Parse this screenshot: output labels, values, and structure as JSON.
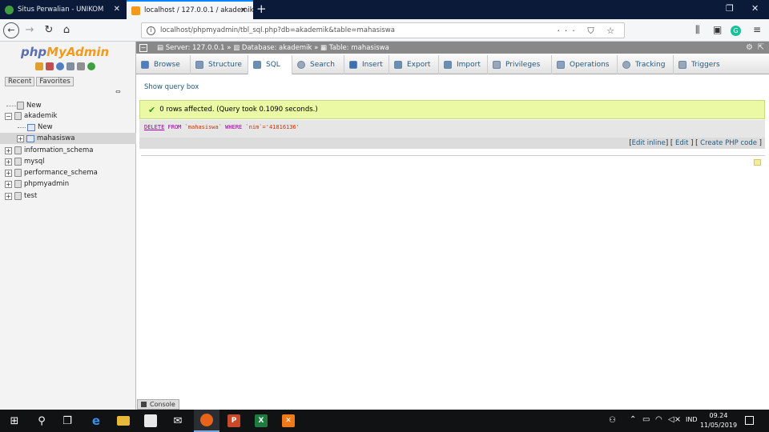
{
  "browser": {
    "tabs": [
      {
        "title": "Situs Perwalian - UNIKOM",
        "active": false
      },
      {
        "title": "localhost / 127.0.0.1 / akademik",
        "active": true
      }
    ],
    "new_tab": "+",
    "url": "localhost/phpmyadmin/tbl_sql.php?db=akademik&table=mahasiswa",
    "url_icons": "··· ⛉ ☆"
  },
  "sidebar": {
    "logo_php": "php",
    "logo_myadmin": "MyAdmin",
    "recent": "Recent",
    "favorites": "Favorites",
    "tree": [
      {
        "label": "New",
        "level": 0,
        "kind": "new"
      },
      {
        "label": "akademik",
        "level": 0,
        "kind": "db",
        "expander": "−"
      },
      {
        "label": "New",
        "level": 1,
        "kind": "new"
      },
      {
        "label": "mahasiswa",
        "level": 1,
        "kind": "table",
        "expander": "+",
        "selected": true
      },
      {
        "label": "information_schema",
        "level": 0,
        "kind": "db",
        "expander": "+"
      },
      {
        "label": "mysql",
        "level": 0,
        "kind": "db",
        "expander": "+"
      },
      {
        "label": "performance_schema",
        "level": 0,
        "kind": "db",
        "expander": "+"
      },
      {
        "label": "phpmyadmin",
        "level": 0,
        "kind": "db",
        "expander": "+"
      },
      {
        "label": "test",
        "level": 0,
        "kind": "db",
        "expander": "+"
      }
    ]
  },
  "breadcrumb": {
    "server": "Server: 127.0.0.1",
    "database": "Database: akademik",
    "table": "Table: mahasiswa"
  },
  "tabs": [
    {
      "label": "Browse",
      "color": "#4d7fbf"
    },
    {
      "label": "Structure",
      "color": "#7f9ab8"
    },
    {
      "label": "SQL",
      "color": "#6a8fb5"
    },
    {
      "label": "Search",
      "color": "#9aa7b8"
    },
    {
      "label": "Insert",
      "color": "#3c6fb0"
    },
    {
      "label": "Export",
      "color": "#6a8fb5"
    },
    {
      "label": "Import",
      "color": "#6a8fb5"
    },
    {
      "label": "Privileges",
      "color": "#9aa7b8"
    },
    {
      "label": "Operations",
      "color": "#8aa0bc"
    },
    {
      "label": "Tracking",
      "color": "#9aa7b8"
    },
    {
      "label": "Triggers",
      "color": "#9aa7b8"
    }
  ],
  "main": {
    "show_query_box": "Show query box",
    "success_message": "0 rows affected. (Query took 0.1090 seconds.)",
    "sql": {
      "kw1": "DELETE",
      "kw2": "FROM",
      "table": "`mahasiswa`",
      "kw3": "WHERE",
      "cond": "`nim`='41816136'"
    },
    "links": {
      "edit_inline": "Edit inline",
      "edit": "Edit",
      "create_php": "Create PHP code"
    },
    "console": "Console"
  },
  "taskbar": {
    "language": "IND",
    "time": "09.24",
    "date": "11/05/2019"
  },
  "colors": {
    "success_bg": "#ebf8a4",
    "link": "#235a81",
    "tab_strip": "#0c1a3a"
  }
}
